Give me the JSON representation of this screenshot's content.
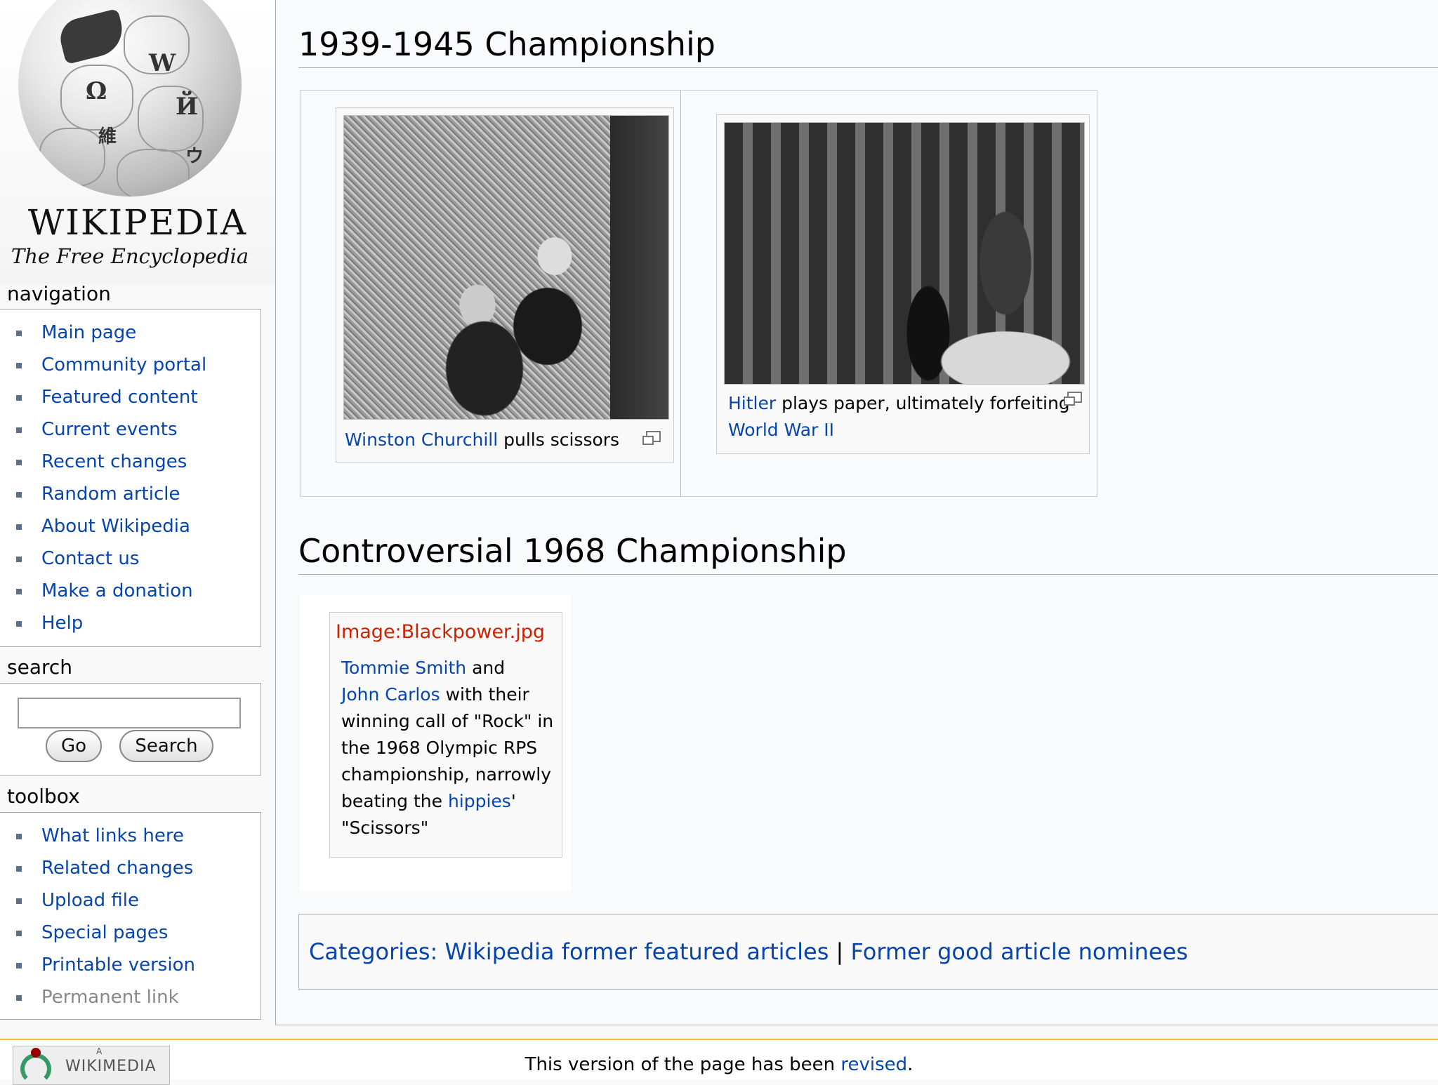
{
  "logo": {
    "wordmark": "WIKIPEDIA",
    "tagline": "The Free Encyclopedia"
  },
  "navigation": {
    "title": "navigation",
    "items": [
      "Main page",
      "Community portal",
      "Featured content",
      "Current events",
      "Recent changes",
      "Random article",
      "About Wikipedia",
      "Contact us",
      "Make a donation",
      "Help"
    ]
  },
  "search": {
    "title": "search",
    "go_label": "Go",
    "search_label": "Search",
    "value": ""
  },
  "toolbox": {
    "title": "toolbox",
    "items": [
      "What links here",
      "Related changes",
      "Upload file",
      "Special pages",
      "Printable version",
      "Permanent link"
    ]
  },
  "sections": {
    "s1": {
      "heading": "1939-1945 Championship"
    },
    "s2": {
      "heading": "Controversial 1968 Championship"
    }
  },
  "gallery1": {
    "churchill": {
      "link": "Winston Churchill",
      "text": " pulls scissors"
    },
    "hitler": {
      "link": "Hitler",
      "text": " plays paper, ultimately forfeiting",
      "link2": "World War II"
    }
  },
  "thumb1968": {
    "missing_image": "Image:Blackpower.jpg",
    "link1": "Tommie Smith",
    "t1": " and",
    "link2": "John Carlos",
    "t2": " with their winning call of \"Rock\" in the 1968 Olympic RPS championship, narrowly beating the ",
    "link3": "hippies",
    "t3": "' \"Scissors\""
  },
  "categories": {
    "label": "Categories",
    "items": [
      "Wikipedia former featured articles",
      "Former good article nominees"
    ]
  },
  "footer": {
    "wikimedia_small": "A",
    "wikimedia": "WIKIMEDIA",
    "text_before": "This version of the page has been ",
    "link": "revised",
    "text_after": "."
  }
}
